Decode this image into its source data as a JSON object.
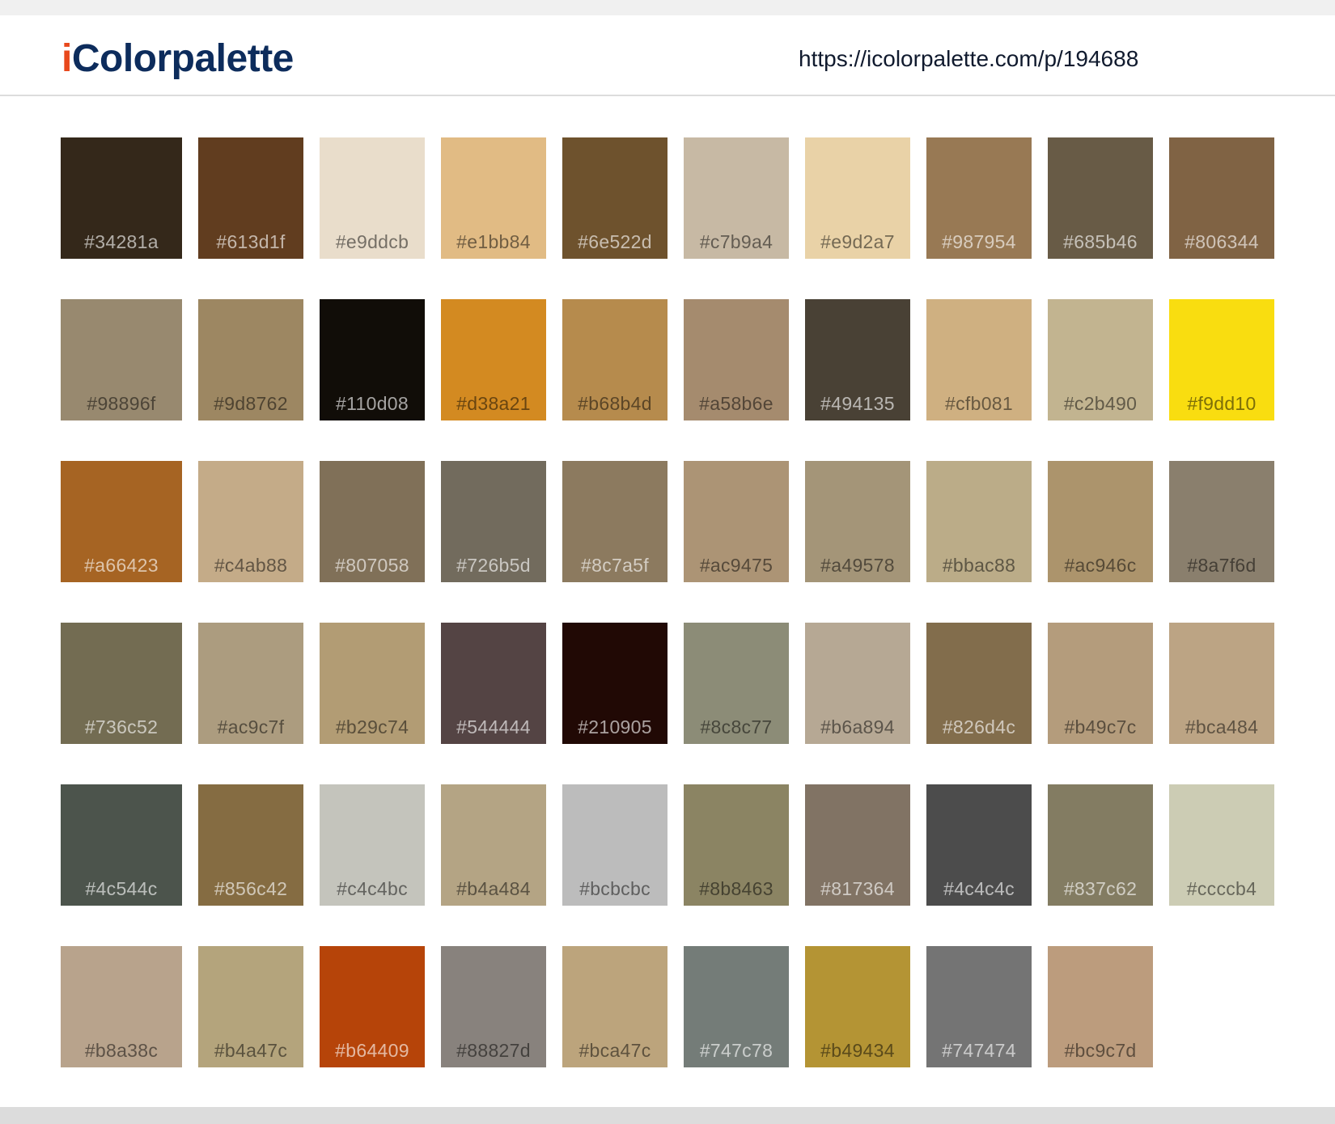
{
  "header": {
    "logo_initial": "i",
    "logo_rest": "Colorpalette",
    "url": "https://icolorpalette.com/p/194688"
  },
  "brand_colors": {
    "logo_initial": "#e8481c",
    "logo_text": "#0d2c5c"
  },
  "swatches": [
    {
      "hex": "#34281a",
      "label": "#34281a"
    },
    {
      "hex": "#613d1f",
      "label": "#613d1f"
    },
    {
      "hex": "#e9ddcb",
      "label": "#e9ddcb"
    },
    {
      "hex": "#e1bb84",
      "label": "#e1bb84"
    },
    {
      "hex": "#6e522d",
      "label": "#6e522d"
    },
    {
      "hex": "#c7b9a4",
      "label": "#c7b9a4"
    },
    {
      "hex": "#e9d2a7",
      "label": "#e9d2a7"
    },
    {
      "hex": "#987954",
      "label": "#987954"
    },
    {
      "hex": "#685b46",
      "label": "#685b46"
    },
    {
      "hex": "#806344",
      "label": "#806344"
    },
    {
      "hex": "#98896f",
      "label": "#98896f"
    },
    {
      "hex": "#9d8762",
      "label": "#9d8762"
    },
    {
      "hex": "#110d08",
      "label": "#110d08"
    },
    {
      "hex": "#d38a21",
      "label": "#d38a21"
    },
    {
      "hex": "#b68b4d",
      "label": "#b68b4d"
    },
    {
      "hex": "#a58b6e",
      "label": "#a58b6e"
    },
    {
      "hex": "#494135",
      "label": "#494135"
    },
    {
      "hex": "#cfb081",
      "label": "#cfb081"
    },
    {
      "hex": "#c2b490",
      "label": "#c2b490"
    },
    {
      "hex": "#f9dd10",
      "label": "#f9dd10"
    },
    {
      "hex": "#a66423",
      "label": "#a66423"
    },
    {
      "hex": "#c4ab88",
      "label": "#c4ab88"
    },
    {
      "hex": "#807058",
      "label": "#807058"
    },
    {
      "hex": "#726b5d",
      "label": "#726b5d"
    },
    {
      "hex": "#8c7a5f",
      "label": "#8c7a5f"
    },
    {
      "hex": "#ac9475",
      "label": "#ac9475"
    },
    {
      "hex": "#a49578",
      "label": "#a49578"
    },
    {
      "hex": "#bbac88",
      "label": "#bbac88"
    },
    {
      "hex": "#ac946c",
      "label": "#ac946c"
    },
    {
      "hex": "#8a7f6d",
      "label": "#8a7f6d"
    },
    {
      "hex": "#736c52",
      "label": "#736c52"
    },
    {
      "hex": "#ac9c7f",
      "label": "#ac9c7f"
    },
    {
      "hex": "#b29c74",
      "label": "#b29c74"
    },
    {
      "hex": "#544444",
      "label": "#544444"
    },
    {
      "hex": "#210905",
      "label": "#210905"
    },
    {
      "hex": "#8c8c77",
      "label": "#8c8c77"
    },
    {
      "hex": "#b6a894",
      "label": "#b6a894"
    },
    {
      "hex": "#826d4c",
      "label": "#826d4c"
    },
    {
      "hex": "#b49c7c",
      "label": "#b49c7c"
    },
    {
      "hex": "#bca484",
      "label": "#bca484"
    },
    {
      "hex": "#4c544c",
      "label": "#4c544c"
    },
    {
      "hex": "#856c42",
      "label": "#856c42"
    },
    {
      "hex": "#c4c4bc",
      "label": "#c4c4bc"
    },
    {
      "hex": "#b4a484",
      "label": "#b4a484"
    },
    {
      "hex": "#bcbcbc",
      "label": "#bcbcbc"
    },
    {
      "hex": "#8b8463",
      "label": "#8b8463"
    },
    {
      "hex": "#817364",
      "label": "#817364"
    },
    {
      "hex": "#4c4c4c",
      "label": "#4c4c4c"
    },
    {
      "hex": "#837c62",
      "label": "#837c62"
    },
    {
      "hex": "#ccccb4",
      "label": "#ccccb4"
    },
    {
      "hex": "#b8a38c",
      "label": "#b8a38c"
    },
    {
      "hex": "#b4a47c",
      "label": "#b4a47c"
    },
    {
      "hex": "#b64409",
      "label": "#b64409"
    },
    {
      "hex": "#88827d",
      "label": "#88827d"
    },
    {
      "hex": "#bca47c",
      "label": "#bca47c"
    },
    {
      "hex": "#747c78",
      "label": "#747c78"
    },
    {
      "hex": "#b49434",
      "label": "#b49434"
    },
    {
      "hex": "#747474",
      "label": "#747474"
    },
    {
      "hex": "#bc9c7d",
      "label": "#bc9c7d"
    }
  ]
}
